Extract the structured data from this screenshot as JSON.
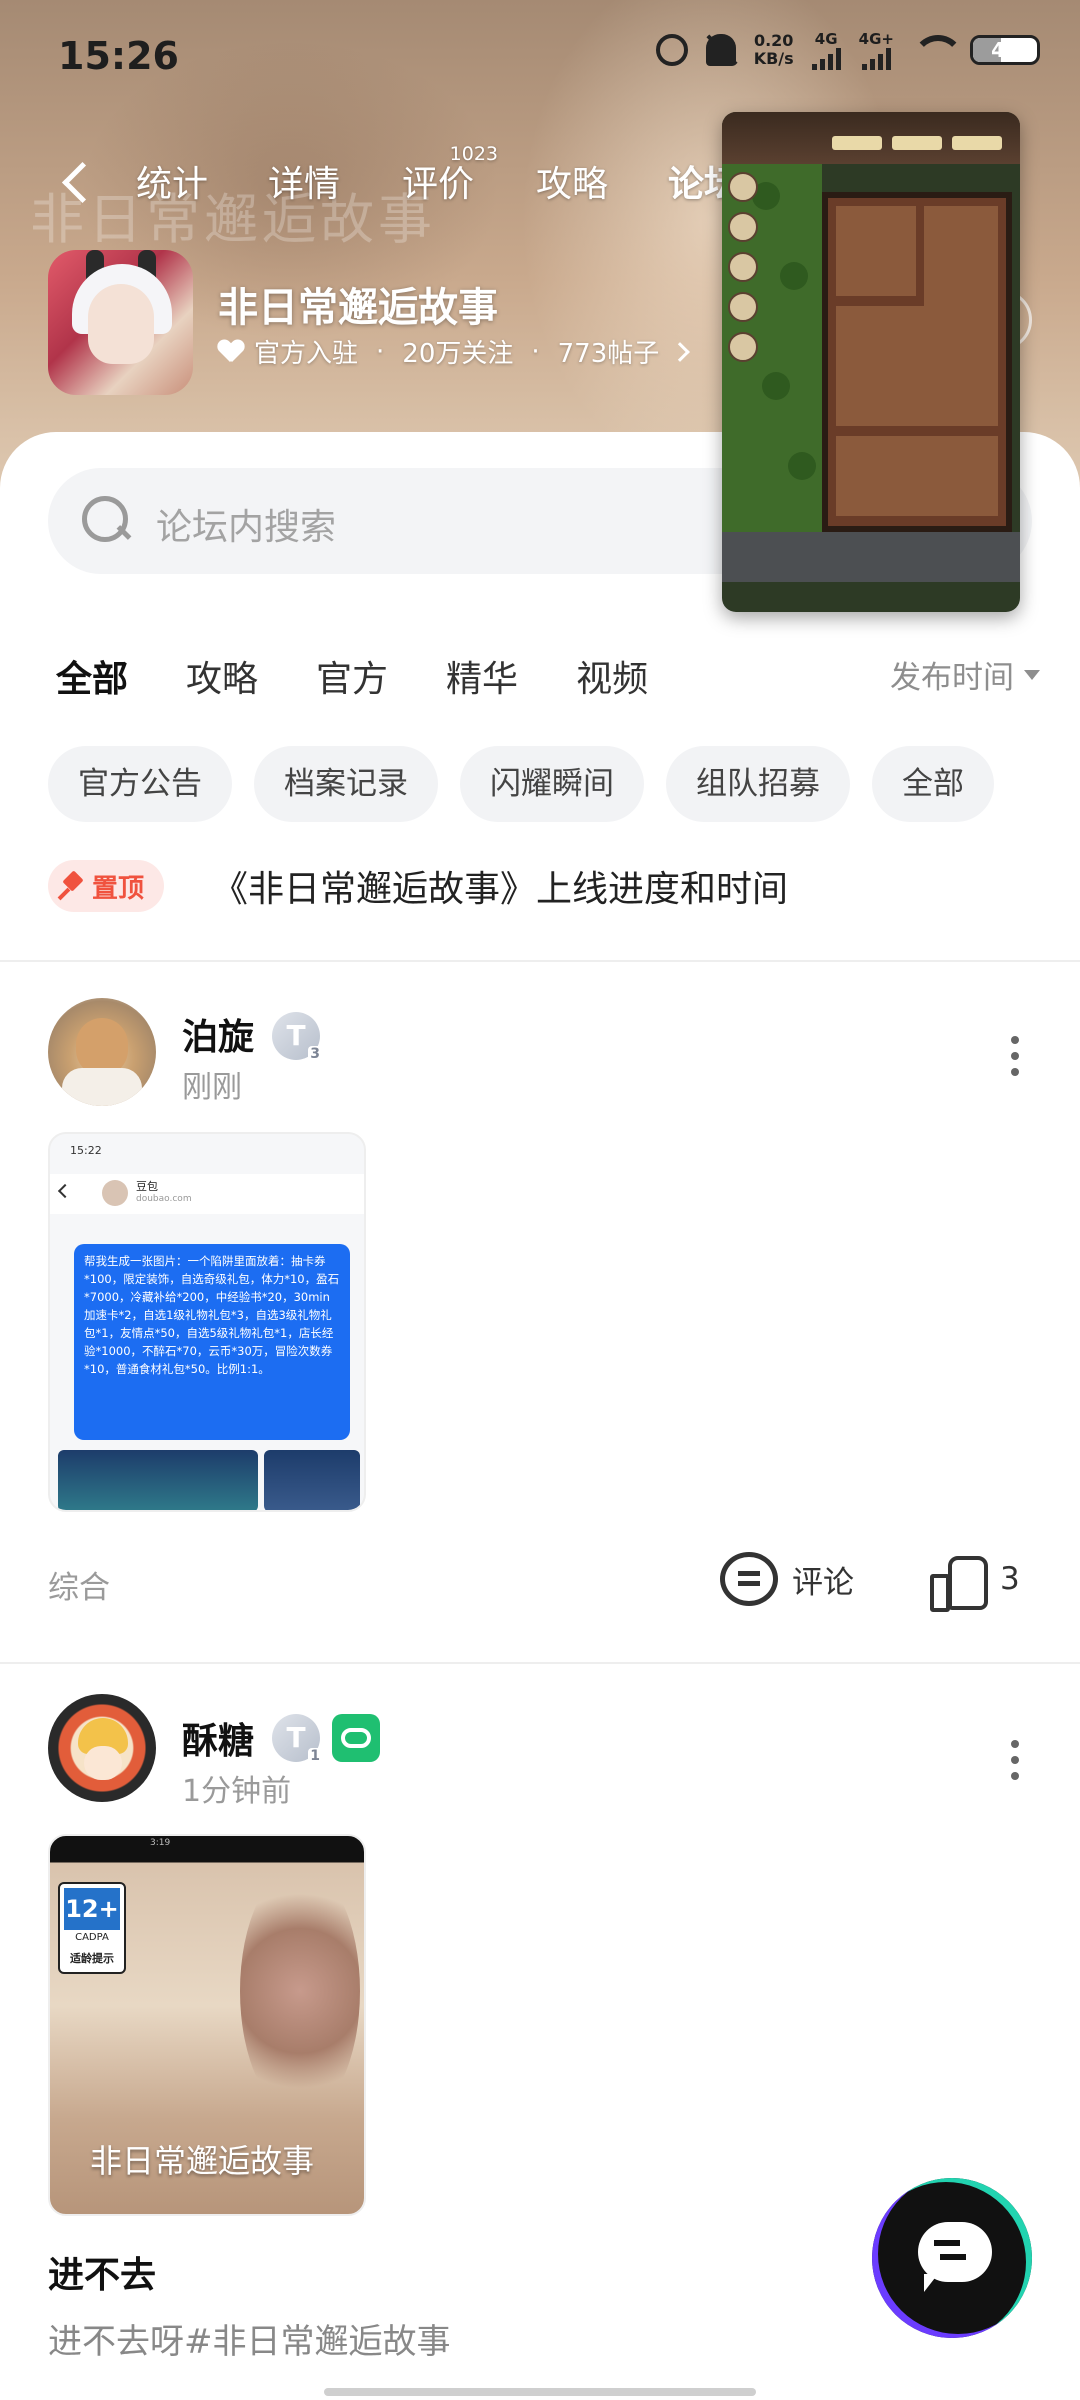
{
  "status_bar": {
    "time": "15:26",
    "net_speed_value": "0.20",
    "net_speed_unit": "KB/s",
    "signal1_label": "4G",
    "signal2_label": "4G+",
    "battery": "44"
  },
  "header": {
    "back_icon": "chevron-left-icon",
    "tabs": [
      {
        "label": "统计"
      },
      {
        "label": "详情"
      },
      {
        "label": "评价",
        "badge": "1023"
      },
      {
        "label": "攻略"
      },
      {
        "label": "论坛"
      }
    ],
    "active_tab": "论坛",
    "watermark_text": "非日常邂逅故事",
    "game_title": "非日常邂逅故事",
    "official_label": "官方入驻",
    "followers": "20万关注",
    "posts": "773帖子"
  },
  "search": {
    "placeholder": "论坛内搜索"
  },
  "category_tabs": [
    "全部",
    "攻略",
    "官方",
    "精华",
    "视频"
  ],
  "active_category": "全部",
  "sort_label": "发布时间",
  "chips": [
    "官方公告",
    "档案记录",
    "闪耀瞬间",
    "组队招募",
    "全部"
  ],
  "pinned": {
    "badge": "置顶",
    "title": "《非日常邂逅故事》上线进度和时间"
  },
  "posts": [
    {
      "username": "泊旋",
      "level": "T",
      "level_num": "3",
      "time": "刚刚",
      "topic": "综合",
      "comment_label": "评论",
      "likes": "3",
      "image": {
        "time": "15:22",
        "contact_name": "豆包",
        "contact_domain": "doubao.com",
        "message": "帮我生成一张图片：一个陷阱里面放着：抽卡券*100，限定装饰，自选奇级礼包，体力*10，盈石*7000，冷藏补给*200，中经验书*20，30min加速卡*2，自选1级礼物礼包*3，自选3级礼物礼包*1，友情点*50，自选5级礼物礼包*1，店长经验*1000，不醉石*70，云币*30万，冒险次数券*10，普通食材礼包*50。比例1:1。"
      }
    },
    {
      "username": "酥糖",
      "level": "T",
      "level_num": "1",
      "time": "1分钟前",
      "title": "进不去",
      "body": "进不去呀#非日常邂逅故事",
      "image": {
        "time": "3:19",
        "age_rating": "12+",
        "age_org": "CADPA",
        "age_tip": "适龄提示",
        "logo_text": "非日常邂逅故事"
      }
    }
  ],
  "colors": {
    "accent": "#2fd3b0",
    "pin_red": "#f0523e",
    "muted": "#9a9a9a"
  }
}
